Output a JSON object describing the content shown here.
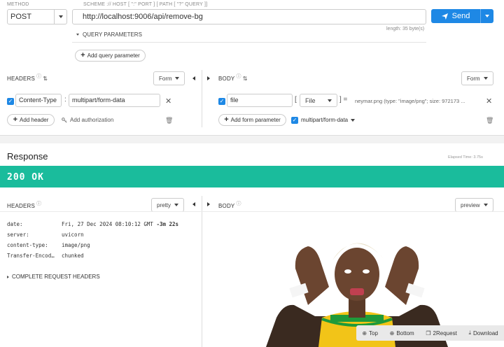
{
  "request": {
    "method_label": "METHOD",
    "method_value": "POST",
    "url_label": "SCHEME :// HOST [ \":\" PORT ] [ PATH [ \"?\" QUERY ]]",
    "url_value": "http://localhost:9006/api/remove-bg",
    "url_length": "length: 35 byte(s)",
    "send_label": "Send",
    "query_params_label": "QUERY PARAMETERS",
    "add_query_param_label": "Add query parameter"
  },
  "headers": {
    "title": "HEADERS",
    "form_select": "Form",
    "rows": [
      {
        "key": "Content-Type",
        "separator": ":",
        "value": "multipart/form-data"
      }
    ],
    "add_header_label": "Add header",
    "add_auth_label": "Add authorization"
  },
  "body": {
    "title": "BODY",
    "form_select": "Form",
    "rows": [
      {
        "key": "file",
        "bracket": "[",
        "type": "File",
        "close_bracket": "] =",
        "value": "neymar.png (type: \"image/png\"; size: 972173 ..."
      }
    ],
    "add_form_param_label": "Add form parameter",
    "encoding": "multipart/form-data"
  },
  "response": {
    "title": "Response",
    "elapsed": "Elapsed Time: 3.75s",
    "status": "200 OK",
    "headers_title": "HEADERS",
    "headers_view": "pretty",
    "body_title": "BODY",
    "body_view": "preview",
    "header_rows": [
      {
        "key": "date:",
        "value": "Fri, 27 Dec 2024 08:10:12 GMT",
        "extra": "-3m 22s"
      },
      {
        "key": "server:",
        "value": "uvicorn",
        "extra": ""
      },
      {
        "key": "content-type:",
        "value": "image/png",
        "extra": ""
      },
      {
        "key": "Transfer-Encod…",
        "value": "chunked",
        "extra": ""
      }
    ],
    "complete_headers_label": "COMPLETE REQUEST HEADERS"
  },
  "toolbar": {
    "top": "Top",
    "bottom": "Bottom",
    "to_request": "2Request",
    "download": "Download"
  },
  "colors": {
    "accent": "#1e88e5",
    "status_ok": "#1abc9c"
  }
}
